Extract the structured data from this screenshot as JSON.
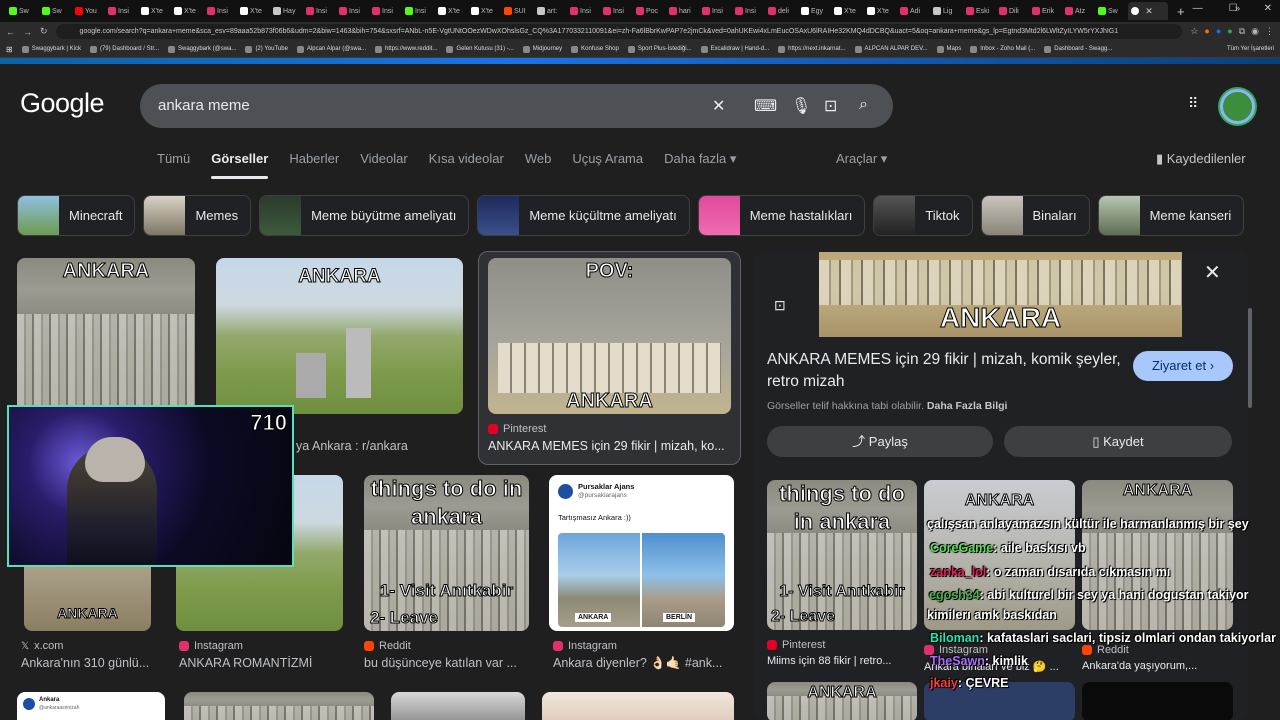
{
  "browser": {
    "tabs": [
      {
        "label": "Sw",
        "color": "#53fc18"
      },
      {
        "label": "Sw",
        "color": "#53fc18"
      },
      {
        "label": "You",
        "color": "#ff0000"
      },
      {
        "label": "Insi",
        "color": "#e1306c"
      },
      {
        "label": "X'te",
        "color": "#ffffff"
      },
      {
        "label": "X'te",
        "color": "#ffffff"
      },
      {
        "label": "Insi",
        "color": "#e1306c"
      },
      {
        "label": "X'te",
        "color": "#ffffff"
      },
      {
        "label": "Hay",
        "color": "#c8c8c8"
      },
      {
        "label": "Insi",
        "color": "#e1306c"
      },
      {
        "label": "Insi",
        "color": "#e1306c"
      },
      {
        "label": "Insi",
        "color": "#e1306c"
      },
      {
        "label": "Insi",
        "color": "#53fc18"
      },
      {
        "label": "X'te",
        "color": "#ffffff"
      },
      {
        "label": "X'te",
        "color": "#ffffff"
      },
      {
        "label": "SUI",
        "color": "#ff4500"
      },
      {
        "label": "art:",
        "color": "#c8c8c8"
      },
      {
        "label": "Insi",
        "color": "#e1306c"
      },
      {
        "label": "Insi",
        "color": "#e1306c"
      },
      {
        "label": "Poc",
        "color": "#e1306c"
      },
      {
        "label": "hari",
        "color": "#e1306c"
      },
      {
        "label": "Insi",
        "color": "#e1306c"
      },
      {
        "label": "Insi",
        "color": "#e1306c"
      },
      {
        "label": "deli",
        "color": "#e1306c"
      },
      {
        "label": "Egy",
        "color": "#ffffff"
      },
      {
        "label": "X'te",
        "color": "#ffffff"
      },
      {
        "label": "X'te",
        "color": "#ffffff"
      },
      {
        "label": "Adi",
        "color": "#e1306c"
      },
      {
        "label": "Lig",
        "color": "#c8c8c8"
      },
      {
        "label": "Eski",
        "color": "#e1306c"
      },
      {
        "label": "Dili",
        "color": "#e1306c"
      },
      {
        "label": "Erik",
        "color": "#e1306c"
      },
      {
        "label": "Atz",
        "color": "#e1306c"
      },
      {
        "label": "Sw",
        "color": "#53fc18"
      }
    ],
    "active_tab": "",
    "url": "google.com/search?q=ankara+meme&sca_esv=89aaa52b873f06b6&udm=2&biw=1463&bih=754&sxsrf=ANbL-n5E-VgtUNtOOezWDwXOhslsGz_CQ%3A1770332110091&ei=zh-Fa6lBbrKwPAP7e2jmCk&ved=0ahUKEwi4xLmEucOSAxU6lRAIHe32KMQ4dDCBQ&uact=5&oq=ankara+meme&gs_lp=Egtnd3Mtd2l6LWltZyILYW5rYXJhIG1",
    "bookmarks": [
      "Swaggybark | Kick",
      "(79) Dashboard / Str...",
      "Swaggybark (@swa...",
      "(2) YouTube",
      "Alpcan Alpar (@swa...",
      "https://www.reddit...",
      "Gelen Kutusu (31) -...",
      "Midjourney",
      "Konfuse Shop",
      "Sport Plus-İstediği...",
      "Excalidraw | Hand-d...",
      "https://next.inkarnat...",
      "ALPCAN ALPAR DEV...",
      "Maps",
      "Inbox - Zoho Mail (...",
      "Dashboard - Swagg..."
    ],
    "bookmarks_more": "»",
    "all_bookmarks": "Tüm Yer İşaretleri"
  },
  "google": {
    "logo": "Google",
    "query": "ankara meme",
    "nav": [
      "Tümü",
      "Görseller",
      "Haberler",
      "Videolar",
      "Kısa videolar",
      "Web",
      "Uçuş Arama",
      "Daha fazla ▾"
    ],
    "active_nav": "Görseller",
    "tools": "Araçlar ▾",
    "saved": "Kaydedilenler",
    "chips": [
      "Minecraft",
      "Memes",
      "Meme büyütme ameliyatı",
      "Meme küçültme ameliyatı",
      "Meme hastalıkları",
      "Tiktok",
      "Binaları",
      "Meme kanseri"
    ]
  },
  "results": [
    {
      "caption": "ANKARA",
      "source": "",
      "title": ""
    },
    {
      "caption": "ANKARA",
      "source": "",
      "title": "ya Ankara : r/ankara"
    },
    {
      "caption": "POV:",
      "caption2": "ANKARA",
      "source": "Pinterest",
      "title": "ANKARA MEMES için 29 fikir | mizah, ko..."
    },
    {
      "caption": "ANKARA",
      "source": "x.com",
      "title": "Ankara'nın 310 günlü..."
    },
    {
      "caption": "",
      "source": "Instagram",
      "title": "ANKARA ROMANTİZMİ"
    },
    {
      "caption": "things to do in ankara",
      "caption2": "1- Visit Anıtkabir",
      "caption3": "2- Leave",
      "source": "Reddit",
      "title": "bu düşünceye katılan var ..."
    },
    {
      "caption": "",
      "source": "Instagram",
      "title": "Ankara diyenler? 👌🏻🤙🏻 #ank..."
    }
  ],
  "tweet_card": {
    "name": "Pursaklar Ajans",
    "handle": "@pursaklarajans",
    "text": "Tartışmasız Ankara :))",
    "left_label": "ANKARA",
    "right_label": "BERLİN"
  },
  "bottom_cards": [
    {
      "name": "Ankara",
      "handle": "@ankaraasrinizah"
    }
  ],
  "panel": {
    "image_caption": "ANKARA",
    "title": "ANKARA MEMES için 29 fikir | mizah, komik şeyler, retro mizah",
    "visit": "Ziyaret et ›",
    "copyright": "Görseller telif hakkına tabi olabilir.",
    "learn_more": "Daha Fazla Bilgi",
    "share": "Paylaş",
    "save": "Kaydet",
    "related": [
      {
        "caption": "things to do in ankara",
        "caption2": "1- Visit Anıtkabir",
        "caption3": "2- Leave",
        "source": "Pinterest",
        "title": "Miims için 88 fikir | retro..."
      },
      {
        "caption": "ANKARA",
        "source": "Instagram",
        "title": "Ankara binaları ve biz 🤔 ..."
      },
      {
        "caption": "ANKARA",
        "source": "Reddit",
        "title": "Ankara'da yaşıyorum,..."
      },
      {
        "caption": "ANKARA",
        "source": "",
        "title": ""
      }
    ]
  },
  "stream": {
    "viewers": "710",
    "chat": [
      {
        "user": "",
        "color": "#ffffff",
        "text": "çalışsan anlayamazsın kültür ile harmanlanmış bir şey"
      },
      {
        "user": "CoreGame",
        "color": "#5be05b",
        "text": ": aile baskısı vb"
      },
      {
        "user": "zanka_lol",
        "color": "#e0245e",
        "text": ": o zaman dısarıda cıkmasın mı"
      },
      {
        "user": "egosh34",
        "color": "#4caf50",
        "text": ": abi kulturel bir sey ya hani dogustan takiyor"
      },
      {
        "user": "",
        "color": "#ffffff",
        "text": "kimilerı amk baskıdan"
      },
      {
        "user": "Biloman",
        "color": "#1de9b6",
        "text": ": kafataslari saclari, tipsiz olmlari ondan takiyorlar"
      },
      {
        "user": "TheSawn",
        "color": "#b06cff",
        "text": ": kimlik"
      },
      {
        "user": "jkaiy",
        "color": "#ff3b3b",
        "text": ": ÇEVRE"
      }
    ]
  }
}
